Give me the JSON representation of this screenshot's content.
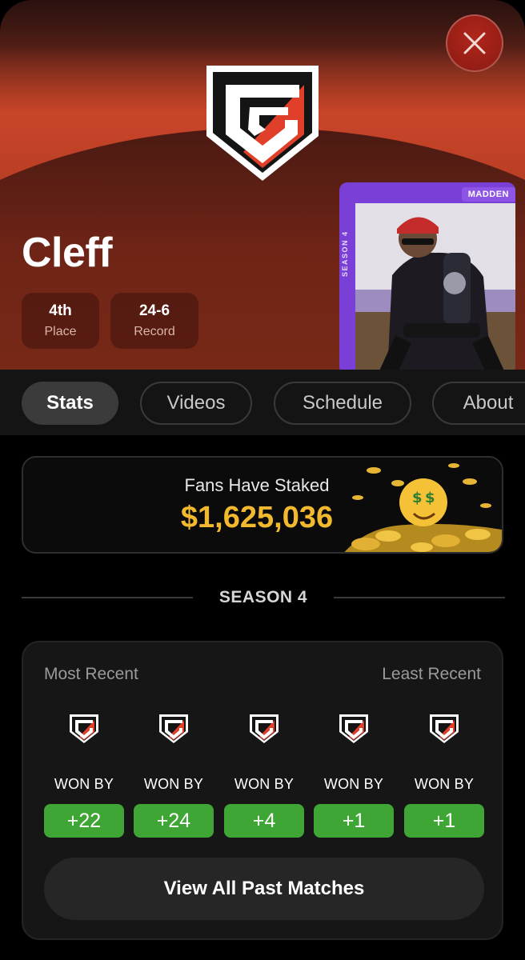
{
  "player": {
    "name": "Cleff",
    "place_value": "4th",
    "place_label": "Place",
    "record_value": "24-6",
    "record_label": "Record"
  },
  "card": {
    "brand_tag": "MADDEN",
    "season_label": "SEASON 4"
  },
  "tabs": [
    {
      "label": "Stats",
      "active": true
    },
    {
      "label": "Videos",
      "active": false
    },
    {
      "label": "Schedule",
      "active": false
    },
    {
      "label": "About",
      "active": false
    }
  ],
  "staked": {
    "caption": "Fans Have Staked",
    "amount": "$1,625,036"
  },
  "season": {
    "label": "SEASON 4"
  },
  "results": {
    "most_recent_label": "Most Recent",
    "least_recent_label": "Least Recent",
    "matches": [
      {
        "result": "WON BY",
        "margin": "+22"
      },
      {
        "result": "WON BY",
        "margin": "+24"
      },
      {
        "result": "WON BY",
        "margin": "+4"
      },
      {
        "result": "WON BY",
        "margin": "+1"
      },
      {
        "result": "WON BY",
        "margin": "+1"
      }
    ],
    "view_all_label": "View All Past Matches"
  },
  "colors": {
    "accent_red": "#c9452a",
    "win_green": "#3fa535",
    "money_gold": "#f2b92f",
    "card_purple": "#7a3fd6"
  },
  "icons": {
    "close": "close-icon",
    "team_logo": "team-logo-icon"
  }
}
